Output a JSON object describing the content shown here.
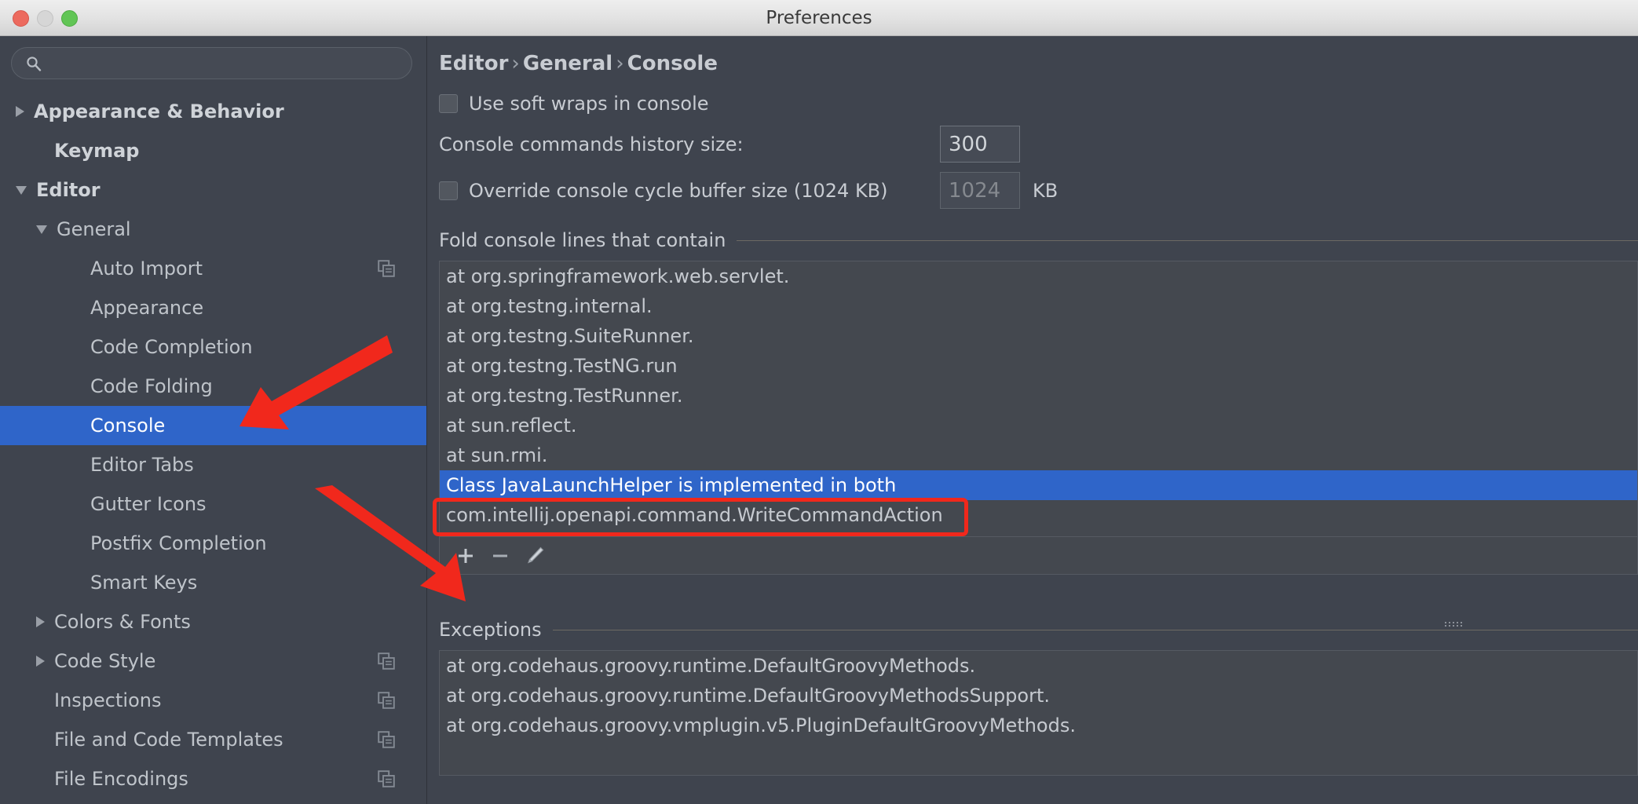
{
  "window": {
    "title": "Preferences",
    "traffic_lights": [
      "close-button",
      "minimize-button",
      "maximize-button"
    ]
  },
  "sidebar": {
    "search": {
      "value": "",
      "placeholder": "",
      "icon": "search-icon"
    },
    "items": [
      {
        "label": "Appearance & Behavior",
        "indent": 0,
        "twisty": "right",
        "bold": true,
        "selected": false,
        "copy_icon": false
      },
      {
        "label": "Keymap",
        "indent": 1,
        "twisty": "none",
        "bold": true,
        "selected": false,
        "copy_icon": false
      },
      {
        "label": "Editor",
        "indent": 0,
        "twisty": "down",
        "bold": true,
        "selected": false,
        "copy_icon": false
      },
      {
        "label": "General",
        "indent": 1,
        "twisty": "down",
        "bold": false,
        "selected": false,
        "copy_icon": false
      },
      {
        "label": "Auto Import",
        "indent": 2,
        "twisty": "none",
        "bold": false,
        "selected": false,
        "copy_icon": true
      },
      {
        "label": "Appearance",
        "indent": 2,
        "twisty": "none",
        "bold": false,
        "selected": false,
        "copy_icon": false
      },
      {
        "label": "Code Completion",
        "indent": 2,
        "twisty": "none",
        "bold": false,
        "selected": false,
        "copy_icon": false
      },
      {
        "label": "Code Folding",
        "indent": 2,
        "twisty": "none",
        "bold": false,
        "selected": false,
        "copy_icon": false
      },
      {
        "label": "Console",
        "indent": 2,
        "twisty": "none",
        "bold": false,
        "selected": true,
        "copy_icon": false
      },
      {
        "label": "Editor Tabs",
        "indent": 2,
        "twisty": "none",
        "bold": false,
        "selected": false,
        "copy_icon": false
      },
      {
        "label": "Gutter Icons",
        "indent": 2,
        "twisty": "none",
        "bold": false,
        "selected": false,
        "copy_icon": false
      },
      {
        "label": "Postfix Completion",
        "indent": 2,
        "twisty": "none",
        "bold": false,
        "selected": false,
        "copy_icon": false
      },
      {
        "label": "Smart Keys",
        "indent": 2,
        "twisty": "none",
        "bold": false,
        "selected": false,
        "copy_icon": false
      },
      {
        "label": "Colors & Fonts",
        "indent": 1,
        "twisty": "right",
        "bold": false,
        "selected": false,
        "copy_icon": false
      },
      {
        "label": "Code Style",
        "indent": 1,
        "twisty": "right",
        "bold": false,
        "selected": false,
        "copy_icon": true
      },
      {
        "label": "Inspections",
        "indent": 1,
        "twisty": "none",
        "bold": false,
        "selected": false,
        "copy_icon": true
      },
      {
        "label": "File and Code Templates",
        "indent": 1,
        "twisty": "none",
        "bold": false,
        "selected": false,
        "copy_icon": true
      },
      {
        "label": "File Encodings",
        "indent": 1,
        "twisty": "none",
        "bold": false,
        "selected": false,
        "copy_icon": true
      }
    ]
  },
  "main": {
    "breadcrumb": {
      "parts": [
        "Editor",
        "General",
        "Console"
      ],
      "separator": "›"
    },
    "soft_wraps": {
      "label": "Use soft wraps in console",
      "checked": false
    },
    "history_size": {
      "label": "Console commands history size:",
      "value": "300"
    },
    "cycle_buffer": {
      "label": "Override console cycle buffer size (1024 KB)",
      "checked": false,
      "value": "1024",
      "unit": "KB",
      "enabled": false
    },
    "fold_group": {
      "title": "Fold console lines that contain",
      "items": [
        {
          "text": "at org.springframework.web.servlet.",
          "selected": false
        },
        {
          "text": "at org.testng.internal.",
          "selected": false
        },
        {
          "text": "at org.testng.SuiteRunner.",
          "selected": false
        },
        {
          "text": "at org.testng.TestNG.run",
          "selected": false
        },
        {
          "text": "at org.testng.TestRunner.",
          "selected": false
        },
        {
          "text": "at sun.reflect.",
          "selected": false
        },
        {
          "text": "at sun.rmi.",
          "selected": false
        },
        {
          "text": "Class JavaLaunchHelper is implemented in both",
          "selected": true
        },
        {
          "text": "com.intellij.openapi.command.WriteCommandAction",
          "selected": false
        }
      ],
      "toolbar": [
        {
          "name": "add-button",
          "glyph": "+"
        },
        {
          "name": "remove-button",
          "glyph": "−"
        },
        {
          "name": "edit-button",
          "glyph": "pencil"
        }
      ]
    },
    "exceptions_group": {
      "title": "Exceptions",
      "items": [
        "at org.codehaus.groovy.runtime.DefaultGroovyMethods.",
        "at org.codehaus.groovy.runtime.DefaultGroovyMethodsSupport.",
        "at org.codehaus.groovy.vmplugin.v5.PluginDefaultGroovyMethods."
      ]
    },
    "splitter": {
      "name": "splitter-drag-handle"
    }
  },
  "annotations": {
    "accent_color": "#f1281c",
    "highlight_color": "#2f65c9",
    "arrow_1": "points-to-console-sidebar-item",
    "arrow_2": "points-to-add-button",
    "box_1": "outlines-selected-fold-rule"
  }
}
